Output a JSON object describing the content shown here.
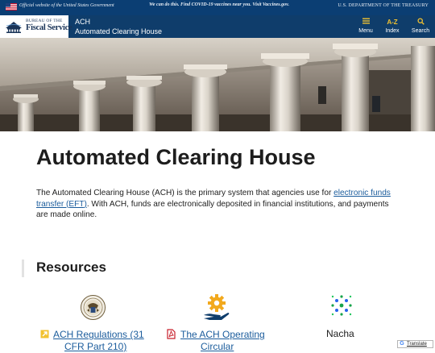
{
  "gov_banner": {
    "official": "Official website of the United States Government",
    "covid_message": "We can do this. Find COVID-19 vaccines near you. Visit Vaccines.gov.",
    "department": "U.S. DEPARTMENT OF THE TREASURY"
  },
  "header": {
    "logo_bureau": "BUREAU OF THE",
    "logo_fiscal": "Fiscal Service",
    "site_abbrev": "ACH",
    "site_title": "Automated Clearing House",
    "nav": [
      {
        "label": "Menu",
        "icon": "hamburger-icon"
      },
      {
        "label": "Index",
        "icon_text": "A-Z"
      },
      {
        "label": "Search",
        "icon": "search-icon"
      }
    ]
  },
  "main": {
    "title": "Automated Clearing House",
    "intro_before": "The Automated Clearing House (ACH) is the primary system that agencies use for ",
    "intro_link": "electronic funds transfer (EFT)",
    "intro_after": ". With ACH, funds are electronically deposited in financial institutions, and payments are made online."
  },
  "resources": {
    "title": "Resources",
    "cards": [
      {
        "icon": "treasury-seal-icon",
        "link_line1": "ACH Regulations (31",
        "link_line2": "CFR Part 210)",
        "link_icon": "external-link-icon"
      },
      {
        "icon": "gear-hand-icon",
        "link_line1": "The ACH Operating",
        "link_line2": "Circular",
        "link_icon": "pdf-icon"
      },
      {
        "icon": "nacha-logo-icon",
        "label": "Nacha"
      }
    ]
  },
  "translate_widget": {
    "label": "Translate"
  },
  "colors": {
    "banner": "#0b3e73",
    "header": "#0f3d6b",
    "accent_gold": "#f2c230",
    "link": "#1b5c9c"
  }
}
